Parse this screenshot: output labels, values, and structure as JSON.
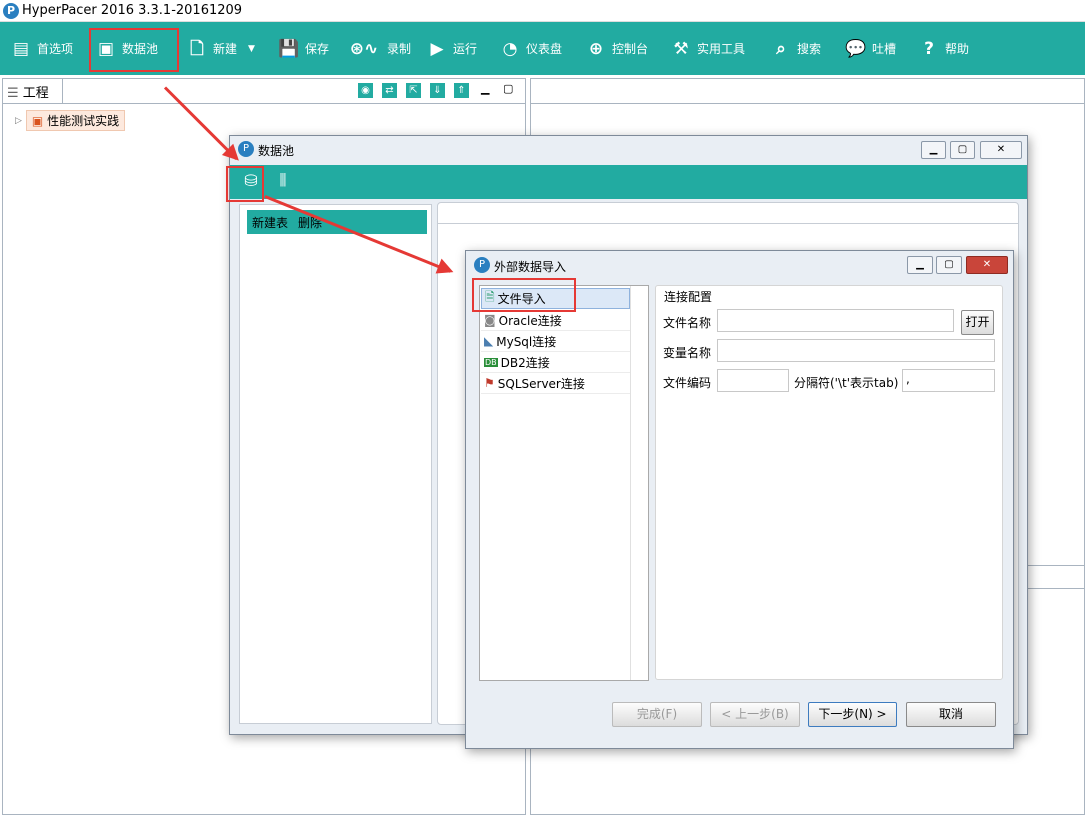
{
  "app": {
    "title": "HyperPacer  2016 3.3.1-20161209"
  },
  "toolbar": {
    "items": [
      {
        "label": "首选项",
        "icon": "preferences-icon"
      },
      {
        "label": "数据池",
        "icon": "datapool-icon"
      },
      {
        "label": "新建",
        "icon": "new-file-icon"
      },
      {
        "label": "保存",
        "icon": "save-icon"
      },
      {
        "label": "录制",
        "icon": "record-icon"
      },
      {
        "label": "运行",
        "icon": "play-icon"
      },
      {
        "label": "仪表盘",
        "icon": "dashboard-icon"
      },
      {
        "label": "控制台",
        "icon": "console-icon"
      },
      {
        "label": "实用工具",
        "icon": "tools-icon"
      },
      {
        "label": "搜索",
        "icon": "search-icon"
      },
      {
        "label": "吐槽",
        "icon": "feedback-icon"
      },
      {
        "label": "帮助",
        "icon": "help-icon"
      }
    ],
    "accent": "#22aba1"
  },
  "project_panel": {
    "tab_label": "工程",
    "tree": [
      {
        "label": "性能测试实践"
      }
    ]
  },
  "datapool_window": {
    "title": "数据池",
    "toolbar_icons": [
      "add-datapool-icon",
      "import-icon"
    ],
    "actions": {
      "new_table": "新建表",
      "delete": "删除"
    }
  },
  "import_dialog": {
    "title": "外部数据导入",
    "sources": [
      {
        "label": "文件导入",
        "icon": "file-icon",
        "selected": true
      },
      {
        "label": "Oracle连接",
        "icon": "oracle-icon"
      },
      {
        "label": "MySql连接",
        "icon": "mysql-icon"
      },
      {
        "label": "DB2连接",
        "icon": "db2-icon"
      },
      {
        "label": "SQLServer连接",
        "icon": "sqlserver-icon"
      }
    ],
    "config": {
      "group_title": "连接配置",
      "file_name_label": "文件名称",
      "file_name_value": "",
      "open_button": "打开",
      "var_name_label": "变量名称",
      "var_name_value": "",
      "encoding_label": "文件编码",
      "encoding_value": "",
      "separator_label": "分隔符('\\t'表示tab)",
      "separator_value": ","
    },
    "buttons": {
      "finish": "完成(F)",
      "back": "< 上一步(B)",
      "next": "下一步(N) >",
      "cancel": "取消"
    }
  },
  "colors": {
    "highlight": "#e53935"
  }
}
